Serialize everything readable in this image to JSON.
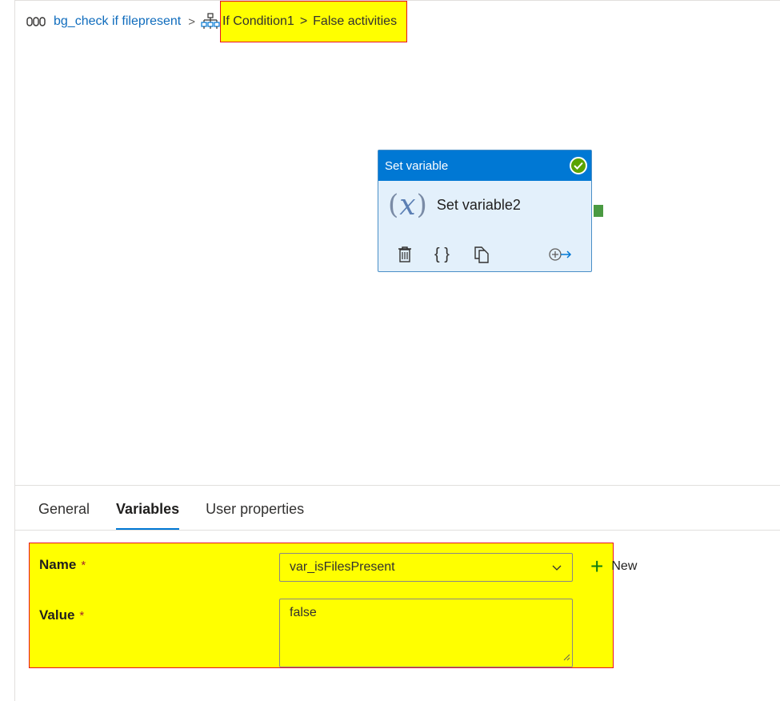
{
  "breadcrumb": {
    "pipeline_name": "bg_check if filepresent",
    "separator": ">",
    "activity": "If Condition1",
    "separator2": ">",
    "branch": "False activities",
    "pipeline_icon": "pipeline-icon",
    "if_condition_icon": "if-condition-icon"
  },
  "activity_card": {
    "type_label": "Set variable",
    "name": "Set variable2",
    "status": "success",
    "status_icon": "check-circle-icon",
    "header_color": "#0078d4",
    "actions": [
      "delete-icon",
      "code-icon",
      "clone-icon",
      "add-output-icon"
    ]
  },
  "properties": {
    "tabs": [
      {
        "label": "General",
        "active": false
      },
      {
        "label": "Variables",
        "active": true
      },
      {
        "label": "User properties",
        "active": false
      }
    ],
    "name_label": "Name",
    "value_label": "Value",
    "required_mark": "*",
    "name_value": "var_isFilesPresent",
    "value_value": "false",
    "new_label": "New"
  },
  "colors": {
    "accent": "#0078d4",
    "highlight": "#ffff00",
    "highlight_border": "#e81123",
    "success": "#5ba300"
  }
}
